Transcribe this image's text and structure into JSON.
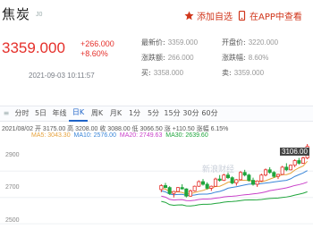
{
  "header": {
    "title": "焦炭",
    "code": "J0",
    "fav_label": "添加自选",
    "app_label": "在APP中查看"
  },
  "quote": {
    "price": "3359.000",
    "change": "+266.000",
    "change_pct": "+8.60%",
    "datetime": "2021-09-03 10:11:57"
  },
  "info": {
    "row1": [
      {
        "label": "最新价:",
        "value": "3359.000"
      },
      {
        "label": "开盘价:",
        "value": "3220.000"
      }
    ],
    "row2": [
      {
        "label": "涨跌额:",
        "value": "266.000"
      },
      {
        "label": "涨跌幅:",
        "value": "8.60%"
      }
    ],
    "row3": [
      {
        "label": "买:",
        "value": "3358.000"
      },
      {
        "label": "卖:",
        "value": "3359.000"
      }
    ]
  },
  "tabs": [
    "≡",
    "分时",
    "5日",
    "年线",
    "日K",
    "周K",
    "月K",
    "1分",
    "5分",
    "15分",
    "30分",
    "60分"
  ],
  "active_tab": 4,
  "kline_info": {
    "line1": "2021/08/02  开 3175.00  高 3208.00  收 3088.00  低 3066.50  涨 +110.50  涨幅 6.15%",
    "ma5": "MA5: 3043.30",
    "ma10": "MA10: 2576.00",
    "ma20": "MA20: 2749.63",
    "ma30": "MA30: 2639.60"
  },
  "chart": {
    "y_labels": [
      "2900",
      "2700",
      "2500"
    ],
    "tooltip": "3106.00",
    "watermark": "新浪财经",
    "colors": {
      "up": "#e5302b",
      "down": "#1fa53c",
      "ma5": "#e6a23c",
      "ma10": "#3b86d8",
      "ma20": "#c940c9",
      "ma30": "#1fa53c"
    }
  },
  "chart_data": {
    "type": "candlestick",
    "note_series": "daily",
    "candles": [
      [
        2760,
        2800,
        2740,
        2790
      ],
      [
        2790,
        2810,
        2770,
        2775
      ],
      [
        2775,
        2785,
        2720,
        2730
      ],
      [
        2730,
        2750,
        2700,
        2745
      ],
      [
        2745,
        2780,
        2740,
        2775
      ],
      [
        2775,
        2800,
        2760,
        2765
      ],
      [
        2765,
        2770,
        2700,
        2710
      ],
      [
        2710,
        2760,
        2705,
        2750
      ],
      [
        2750,
        2790,
        2745,
        2785
      ],
      [
        2785,
        2830,
        2780,
        2820
      ],
      [
        2820,
        2840,
        2790,
        2800
      ],
      [
        2800,
        2815,
        2760,
        2770
      ],
      [
        2770,
        2790,
        2750,
        2785
      ],
      [
        2785,
        2850,
        2780,
        2840
      ],
      [
        2840,
        2870,
        2820,
        2830
      ],
      [
        2830,
        2880,
        2825,
        2870
      ],
      [
        2870,
        2890,
        2840,
        2850
      ],
      [
        2850,
        2860,
        2800,
        2810
      ],
      [
        2810,
        2840,
        2790,
        2835
      ],
      [
        2835,
        2900,
        2830,
        2890
      ],
      [
        2890,
        2910,
        2860,
        2870
      ],
      [
        2870,
        2880,
        2820,
        2830
      ],
      [
        2830,
        2850,
        2790,
        2800
      ],
      [
        2800,
        2830,
        2780,
        2825
      ],
      [
        2825,
        2880,
        2820,
        2870
      ],
      [
        2870,
        2920,
        2860,
        2910
      ],
      [
        2910,
        2930,
        2880,
        2890
      ],
      [
        2890,
        2900,
        2850,
        2860
      ],
      [
        2860,
        2880,
        2840,
        2875
      ],
      [
        2875,
        2940,
        2870,
        2930
      ],
      [
        2930,
        2960,
        2900,
        2910
      ],
      [
        2910,
        2950,
        2905,
        2945
      ],
      [
        2945,
        2990,
        2930,
        2980
      ],
      [
        2980,
        3000,
        2950,
        2960
      ],
      [
        2960,
        3010,
        2955,
        3000
      ],
      [
        3000,
        3106,
        2990,
        3088
      ]
    ]
  }
}
